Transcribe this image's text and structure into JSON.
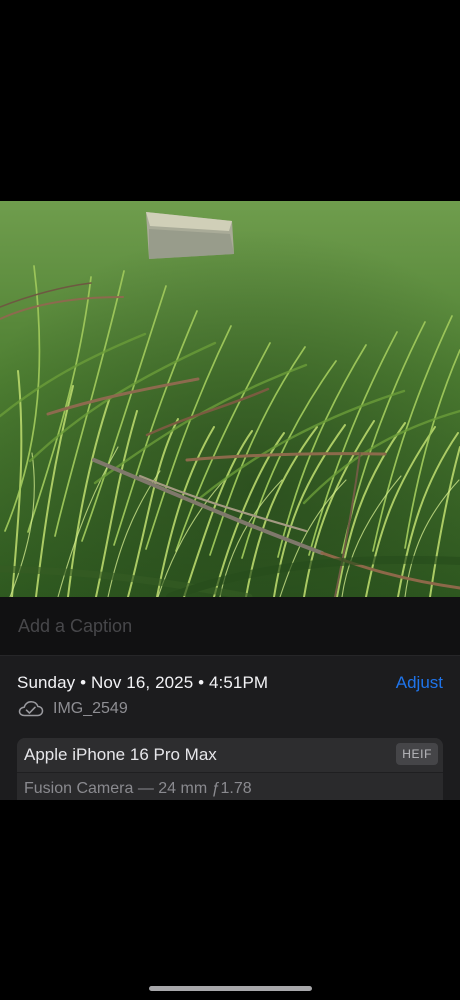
{
  "photo": {
    "subject": "grass",
    "icon": "photo-image"
  },
  "caption": {
    "placeholder": "Add a Caption"
  },
  "metadata": {
    "datetime": "Sunday • Nov 16, 2025 • 4:51PM",
    "adjust_label": "Adjust",
    "filename": "IMG_2549",
    "sync_icon": "cloud-check-icon",
    "device": "Apple iPhone 16 Pro Max",
    "format_badge": "HEIF",
    "camera": "Fusion Camera — 24 mm ƒ1.78"
  },
  "colors": {
    "accent": "#1f74ea",
    "background": "#000000",
    "panel": "#1c1c1e"
  }
}
